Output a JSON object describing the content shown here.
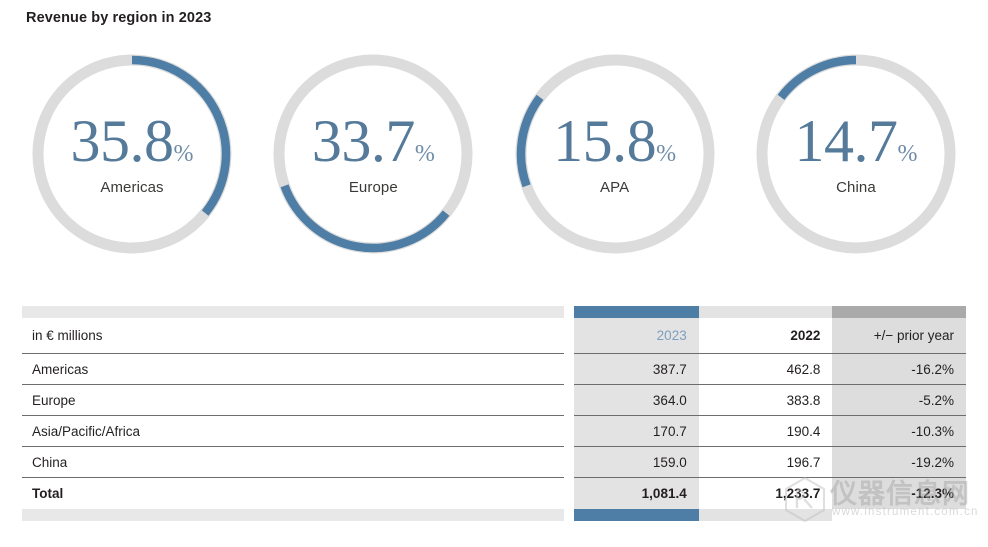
{
  "title": "Revenue by region in 2023",
  "colors": {
    "arc": "#4e7ea5",
    "track": "#dcdcdc",
    "value_text": "#557a9a",
    "header_2023": "#7d9fbe",
    "col_2023_bg": "#e3e3e3",
    "col_delta_bg": "#dddddd",
    "cap_delta": "#aaaaaa",
    "cap_label": "#e8e8e8",
    "rule": "#6d6d6d"
  },
  "donuts": [
    {
      "value": "35.8",
      "percent_symbol": "%",
      "label": "Americas",
      "fraction": 35.8,
      "start_deg": 0,
      "end_deg": 128.9
    },
    {
      "value": "33.7",
      "percent_symbol": "%",
      "label": "Europe",
      "fraction": 33.7,
      "start_deg": 128.9,
      "end_deg": 250.2
    },
    {
      "value": "15.8",
      "percent_symbol": "%",
      "label": "APA",
      "fraction": 15.8,
      "start_deg": 250.2,
      "end_deg": 307.1
    },
    {
      "value": "14.7",
      "percent_symbol": "%",
      "label": "China",
      "fraction": 14.7,
      "start_deg": 307.1,
      "end_deg": 360.0
    }
  ],
  "table": {
    "columns": [
      "in € millions",
      "2023",
      "2022",
      "+/− prior year"
    ],
    "rows": [
      {
        "label": "Americas",
        "v2023": "387.7",
        "v2022": "462.8",
        "delta": "-16.2%"
      },
      {
        "label": "Europe",
        "v2023": "364.0",
        "v2022": "383.8",
        "delta": "-5.2%"
      },
      {
        "label": "Asia/Pacific/Africa",
        "v2023": "170.7",
        "v2022": "190.4",
        "delta": "-10.3%"
      },
      {
        "label": "China",
        "v2023": "159.0",
        "v2022": "196.7",
        "delta": "-19.2%"
      }
    ],
    "total": {
      "label": "Total",
      "v2023": "1,081.4",
      "v2022": "1,233.7",
      "delta": "-12.3%"
    }
  },
  "watermark": {
    "text": "仪器信息网",
    "url": "www.instrument.com.cn"
  },
  "chart_data": {
    "type": "pie",
    "title": "Revenue by region in 2023",
    "categories": [
      "Americas",
      "Europe",
      "APA",
      "China"
    ],
    "values": [
      35.8,
      33.7,
      15.8,
      14.7
    ],
    "unit": "%",
    "legend": "none",
    "table": {
      "type": "table",
      "unit": "€ millions",
      "columns": [
        "in € millions",
        "2023",
        "2022",
        "+/− prior year"
      ],
      "rows": [
        [
          "Americas",
          387.7,
          462.8,
          "-16.2%"
        ],
        [
          "Europe",
          364.0,
          383.8,
          "-5.2%"
        ],
        [
          "Asia/Pacific/Africa",
          170.7,
          190.4,
          "-10.3%"
        ],
        [
          "China",
          159.0,
          196.7,
          "-19.2%"
        ],
        [
          "Total",
          1081.4,
          1233.7,
          "-12.3%"
        ]
      ]
    }
  }
}
